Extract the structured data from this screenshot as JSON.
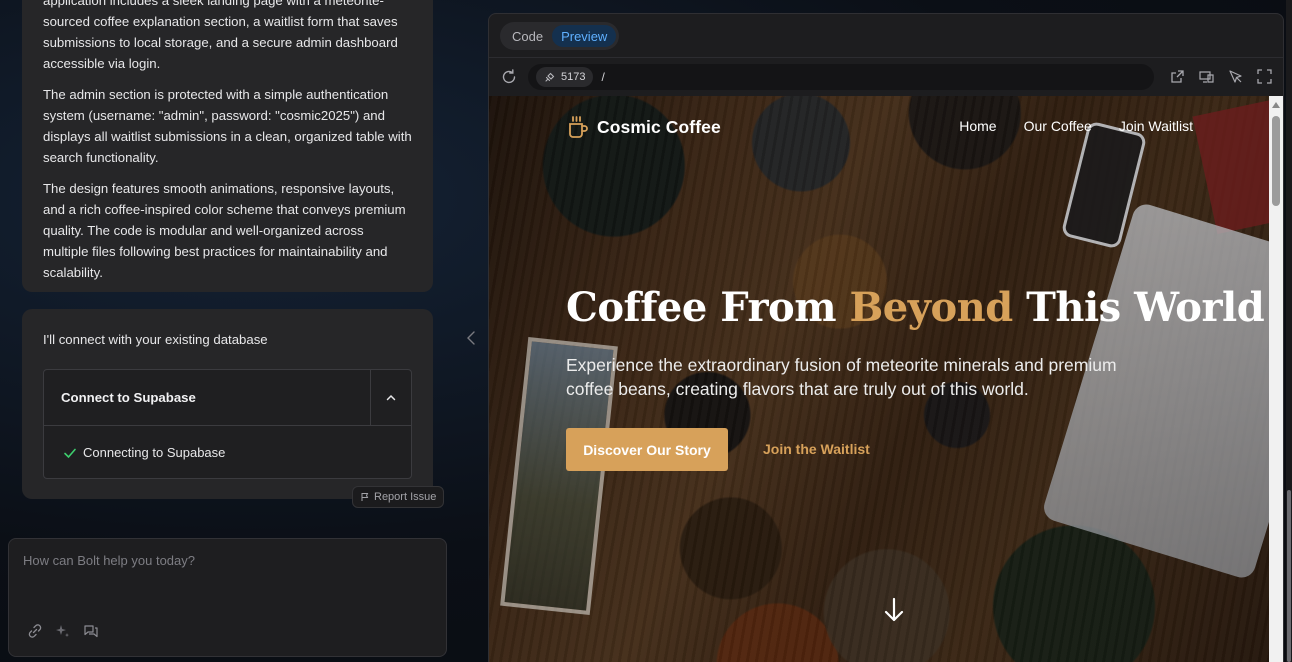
{
  "chat": {
    "paragraphs": [
      "application includes a sleek landing page with a meteorite-sourced coffee explanation section, a waitlist form that saves submissions to local storage, and a secure admin dashboard accessible via login.",
      "The admin section is protected with a simple authentication system (username: \"admin\", password: \"cosmic2025\") and displays all waitlist submissions in a clean, organized table with search functionality.",
      "The design features smooth animations, responsive layouts, and a rich coffee-inspired color scheme that conveys premium quality. The code is modular and well-organized across multiple files following best practices for maintainability and scalability."
    ],
    "db_message": "I'll connect with your existing database",
    "supabase_title": "Connect to Supabase",
    "supabase_status": "Connecting to Supabase",
    "report_issue": "Report Issue",
    "prompt_placeholder": "How can Bolt help you today?"
  },
  "preview": {
    "tabs": [
      "Code",
      "Preview"
    ],
    "active_tab": "Preview",
    "port": "5173",
    "path": "/"
  },
  "site": {
    "brand": "Cosmic Coffee",
    "nav": [
      "Home",
      "Our Coffee",
      "Join Waitlist"
    ],
    "hero_title_part1": "Coffee From ",
    "hero_title_accent": "Beyond",
    "hero_title_part2": " This World",
    "hero_subtitle": "Experience the extraordinary fusion of meteorite minerals and premium coffee beans, creating flavors that are truly out of this world.",
    "cta_primary": "Discover Our Story",
    "cta_secondary": "Join the Waitlist",
    "accent_color": "#d7a15a"
  },
  "icons": [
    "check-icon",
    "chevron-up-icon",
    "flag-icon",
    "link-icon",
    "sparkle-icon",
    "chat-icon",
    "chevron-left-icon",
    "refresh-icon",
    "plug-icon",
    "external-link-icon",
    "device-icon",
    "inspect-icon",
    "fullscreen-icon",
    "coffee-cup-icon",
    "arrow-down-icon"
  ]
}
